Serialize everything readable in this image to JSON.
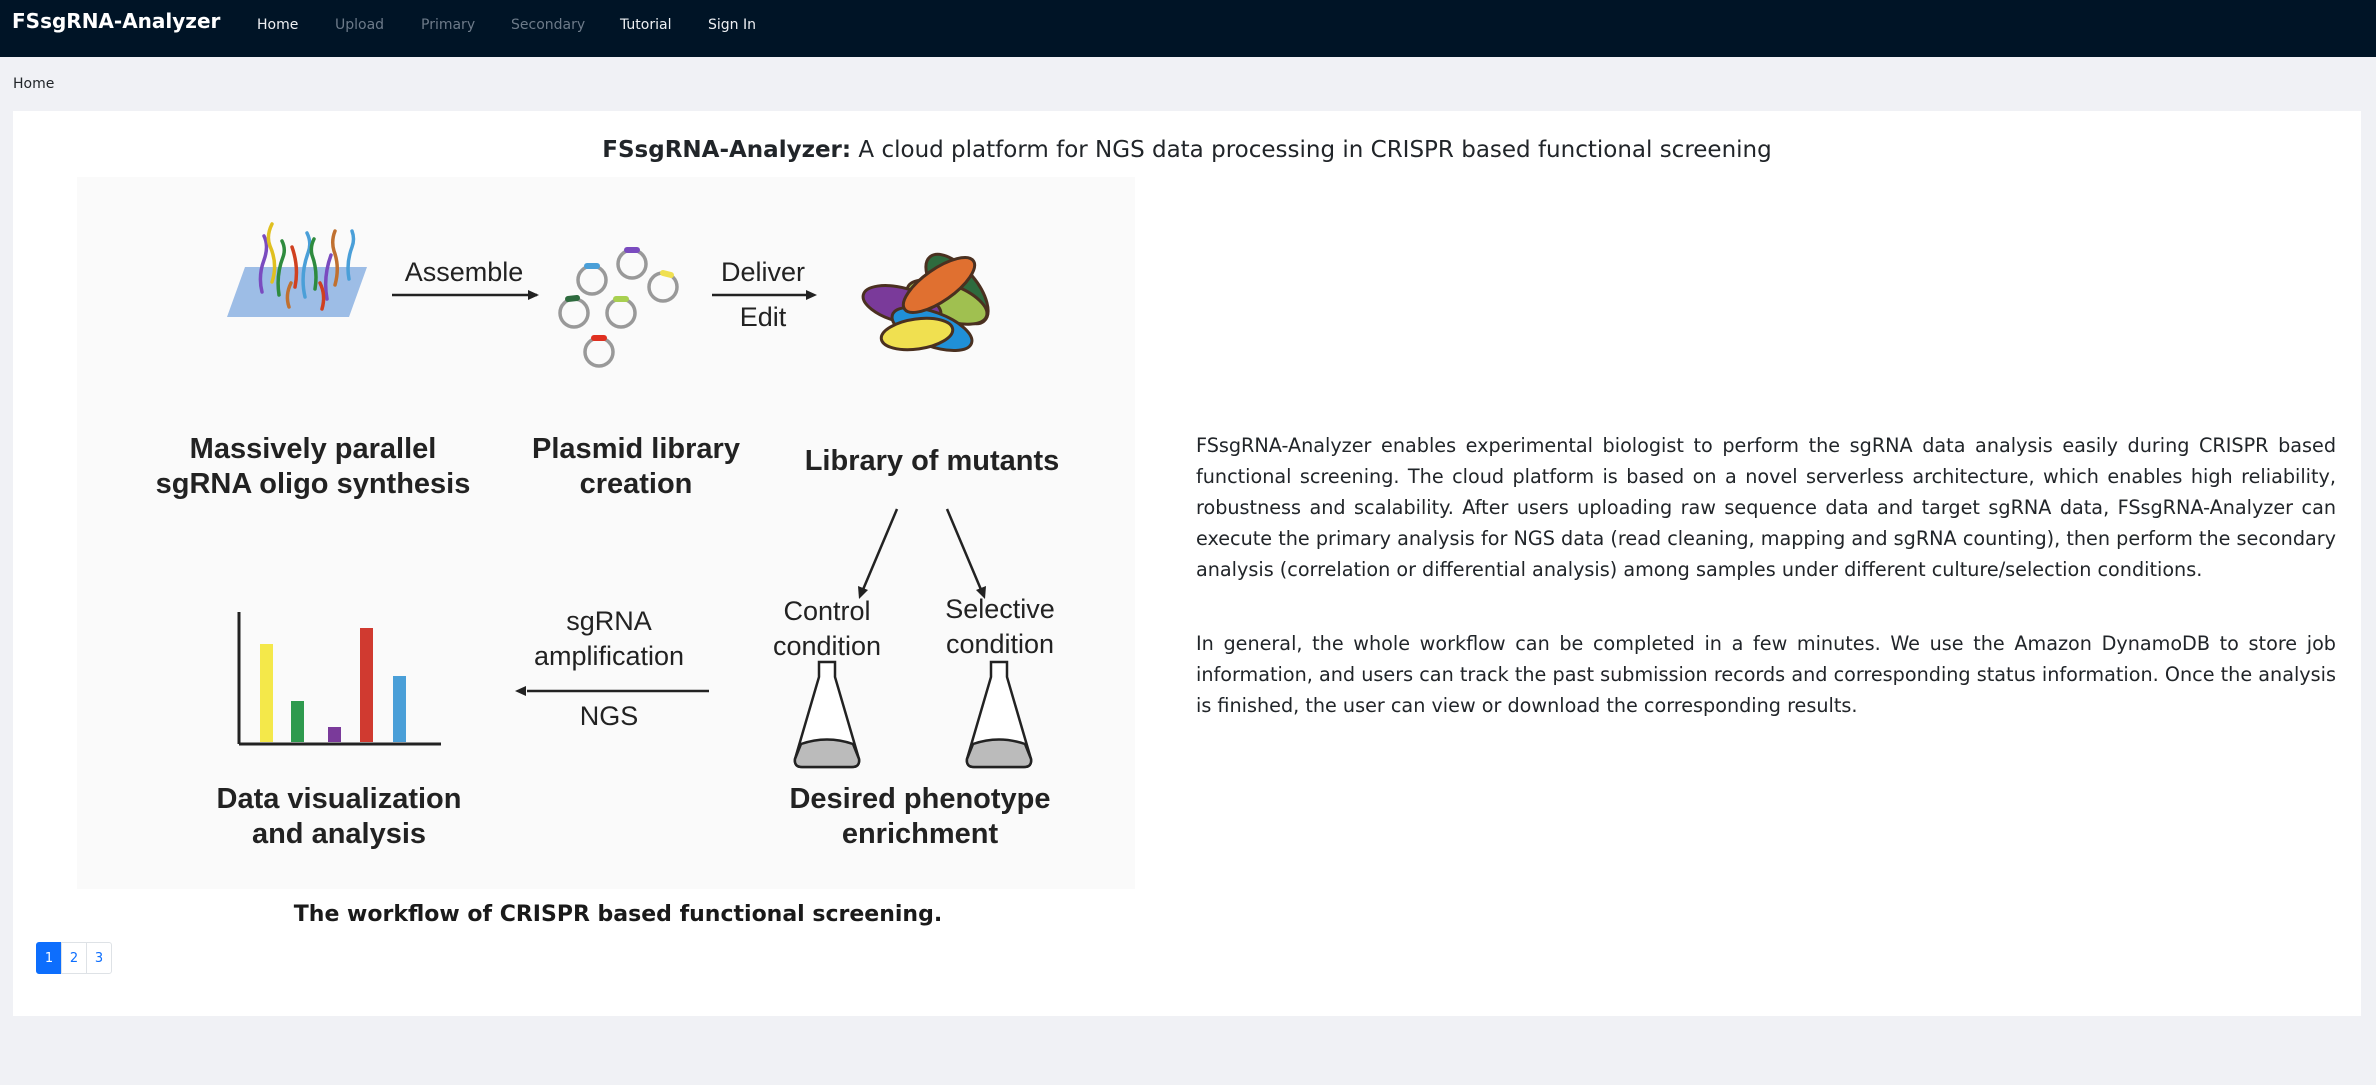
{
  "nav": {
    "brand": "FSsgRNA-Analyzer",
    "links": [
      "Home",
      "Upload",
      "Primary",
      "Secondary",
      "Tutorial",
      "Sign In"
    ]
  },
  "breadcrumb": "Home",
  "main": {
    "title_bold": "FSsgRNA-Analyzer:",
    "title_rest": " A cloud platform for NGS data processing in CRISPR based functional screening",
    "figure": {
      "assemble": "Assemble",
      "deliver": "Deliver",
      "edit": "Edit",
      "step1_line1": "Massively parallel",
      "step1_line2": "sgRNA oligo synthesis",
      "step2_line1": "Plasmid library",
      "step2_line2": "creation",
      "step3": "Library of mutants",
      "control_line1": "Control",
      "control_line2": "condition",
      "selective_line1": "Selective",
      "selective_line2": "condition",
      "amp_line1": "sgRNA",
      "amp_line2": "amplification",
      "ngs": "NGS",
      "step4_line1": "Data visualization",
      "step4_line2": "and analysis",
      "step5_line1": "Desired phenotype",
      "step5_line2": "enrichment"
    },
    "caption": "The workflow of CRISPR based functional screening.",
    "paragraph1": "FSsgRNA-Analyzer enables experimental biologist to perform the sgRNA data analysis easily during CRISPR based functional screening. The cloud platform is based on a novel serverless architecture, which enables high reliability, robustness and scalability. After users uploading raw sequence data and target sgRNA data, FSsgRNA-Analyzer can execute the primary analysis for NGS data (read cleaning, mapping and sgRNA counting), then perform the secondary analysis (correlation or differential analysis) among samples under different culture/selection conditions.",
    "paragraph2": "In general, the whole workflow can be completed in a few minutes. We use the Amazon DynamoDB to store job information, and users can track the past submission records and corresponding status information. Once the analysis is finished, the user can view or download the corresponding results.",
    "pages": [
      "1",
      "2",
      "3"
    ],
    "active_page": "1"
  },
  "colors": {
    "navbar": "#001426",
    "primary": "#0d6efd"
  }
}
